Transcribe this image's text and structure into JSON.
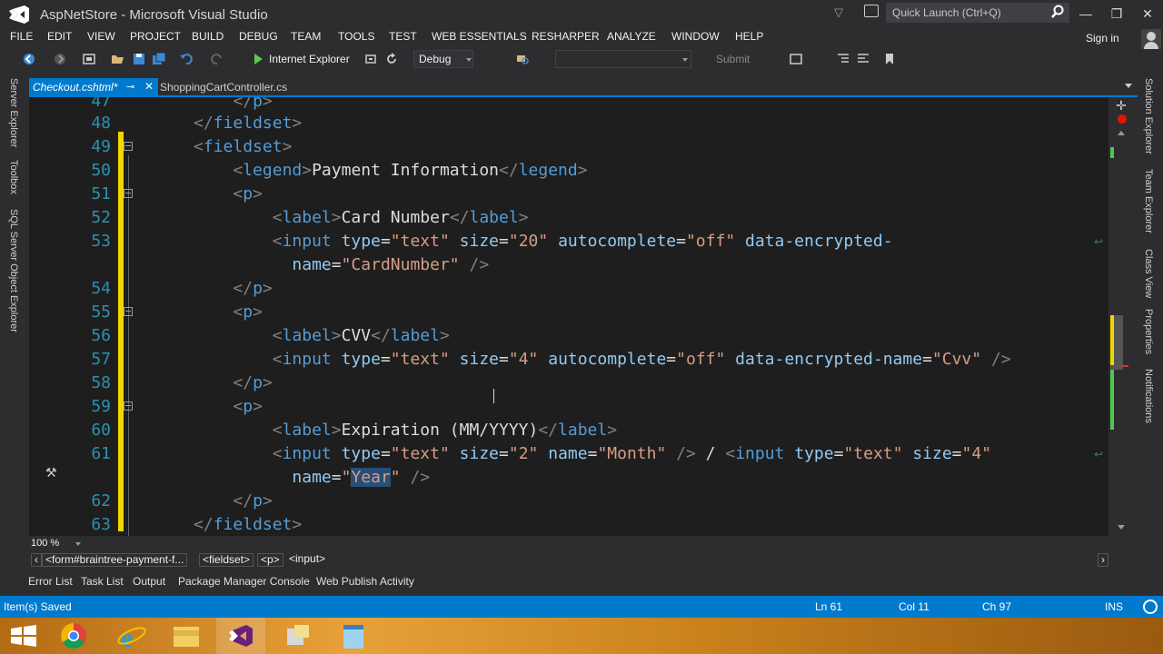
{
  "window": {
    "title": "AspNetStore - Microsoft Visual Studio",
    "quick_launch_placeholder": "Quick Launch (Ctrl+Q)"
  },
  "menu": {
    "items": [
      "FILE",
      "EDIT",
      "VIEW",
      "PROJECT",
      "BUILD",
      "DEBUG",
      "TEAM",
      "TOOLS",
      "TEST",
      "WEB ESSENTIALS",
      "RESHARPER",
      "ANALYZE",
      "WINDOW",
      "HELP"
    ],
    "sign_in": "Sign in"
  },
  "toolbar": {
    "run_target": "Internet Explorer",
    "configuration": "Debug",
    "submit": "Submit"
  },
  "left_dock": {
    "tabs": [
      "Server Explorer",
      "Toolbox",
      "SQL Server Object Explorer"
    ]
  },
  "right_dock": {
    "tabs": [
      "Solution Explorer",
      "Team Explorer",
      "Class View",
      "Properties",
      "Notifications"
    ]
  },
  "tabs": {
    "active": "Checkout.cshtml*",
    "second": "ShoppingCartController.cs"
  },
  "editor": {
    "line_numbers": [
      "47",
      "48",
      "49",
      "50",
      "51",
      "52",
      "53",
      "",
      "54",
      "55",
      "56",
      "57",
      "58",
      "59",
      "60",
      "61",
      "",
      "62",
      "63"
    ],
    "selected_text": "Year",
    "zoom": "100 %"
  },
  "breadcrumb": [
    "<form#braintree-payment-f...",
    "<fieldset>",
    "<p>",
    "<input>"
  ],
  "bottom_tabs": [
    "Error List",
    "Task List",
    "Output",
    "Package Manager Console",
    "Web Publish Activity"
  ],
  "status": {
    "message": "Item(s) Saved",
    "line": "Ln 61",
    "col": "Col 11",
    "ch": "Ch 97",
    "mode": "INS"
  },
  "colors": {
    "accent": "#007acc",
    "tag": "#569cd6",
    "attribute": "#92caf4",
    "value": "#d69d85",
    "change_marker": "#efd700"
  },
  "taskbar": {
    "apps": [
      "start-icon",
      "chrome-icon",
      "internet-explorer-icon",
      "file-explorer-icon",
      "visual-studio-icon",
      "tools-icon",
      "notepad-icon"
    ]
  }
}
